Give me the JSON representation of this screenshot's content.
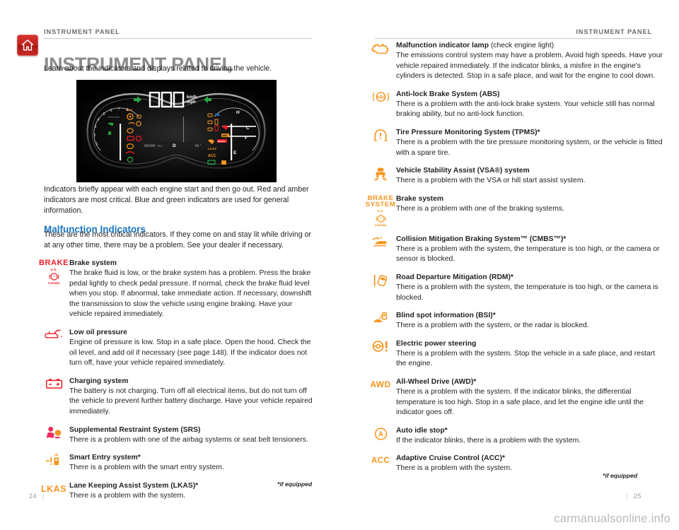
{
  "header": {
    "breadcrumb_left": "INSTRUMENT PANEL",
    "breadcrumb_right": "INSTRUMENT PANEL",
    "title": "INSTRUMENT PANEL",
    "intro": "Learn about the indicators and displays related to driving the vehicle.",
    "home_icon": "home-icon"
  },
  "colors": {
    "title_gray": "#8b8b8b",
    "section_blue": "#1b75bb",
    "red": "#ed1c24",
    "amber": "#f7941e",
    "home_red": "#c0241e",
    "rule_gray": "#c9c9c9"
  },
  "gauge": {
    "alt": "instrument-panel-cluster-illustration",
    "speed_digits": "000",
    "unit_top": "km/h",
    "unit_bottom": "mph",
    "odometer": "002345",
    "odometer_unit": "miles",
    "gear": "D",
    "temperature": "63",
    "temperature_unit": "F",
    "tach_labels": [
      "1",
      "2",
      "3",
      "4",
      "5",
      "6",
      "7",
      "8"
    ],
    "tach_unit": "x1000 r/min",
    "fuel_label_full": "F",
    "fuel_label_empty": "E",
    "temp_label_hot": "H",
    "temp_label_cold": "C",
    "cluster_badges": [
      "AWD",
      "LKAS",
      "ACC",
      "BRAKE"
    ]
  },
  "body": {
    "paragraph": "Indicators briefly appear with each engine start and then go out. Red and amber indicators are most critical. Blue and green indicators are used for general information.",
    "section_title": "Malfunction Indicators",
    "section_paragraph": "These are the most critical indicators. If they come on and stay lit while driving or at any other time, there may be a problem. See your dealer if necessary."
  },
  "footnotes": {
    "left": "*if equipped",
    "right": "*if equipped"
  },
  "folio": {
    "left_page": "24",
    "right_page": "25",
    "separator": "|"
  },
  "watermark": "carmanualsonline.info",
  "indicators_left": [
    {
      "icon": "brake-system-warning-icon",
      "icon_kind": "brake-text-red",
      "icon_text": "BRAKE",
      "icon_sub1": "U.S.",
      "icon_sub2": "Canada",
      "title": "Brake system",
      "desc": "The brake fluid is low, or the brake system has a problem. Press the brake pedal lightly to check pedal pressure. If normal, check the brake fluid level when you stop. If abnormal, take immediate action. If necessary, downshift the transmission to slow the vehicle using engine braking. Have your vehicle repaired immediately."
    },
    {
      "icon": "low-oil-pressure-icon",
      "icon_kind": "oil-can",
      "title": "Low oil pressure",
      "desc": "Engine oil pressure is low. Stop in a safe place. Open the hood. Check the oil level, and add oil if necessary (see page 148). If the indicator does not turn off, have your vehicle repaired immediately."
    },
    {
      "icon": "charging-system-icon",
      "icon_kind": "battery",
      "title": "Charging system",
      "desc": "The battery is not charging. Turn off all electrical items, but do not turn off the vehicle to prevent further battery discharge. Have your vehicle repaired immediately."
    },
    {
      "icon": "srs-airbag-icon",
      "icon_kind": "srs",
      "title": "Supplemental Restraint System (SRS)",
      "desc": "There is a problem with one of the airbag systems or seat belt tensioners."
    },
    {
      "icon": "smart-entry-icon",
      "icon_kind": "smart-entry",
      "title": "Smart Entry system*",
      "desc": "There is a problem with the smart entry system."
    },
    {
      "icon": "lkas-icon",
      "icon_kind": "lkas-text",
      "icon_text": "LKAS",
      "title": "Lane Keeping Assist System (LKAS)*",
      "desc": "There is a problem with the system."
    }
  ],
  "indicators_right": [
    {
      "icon": "check-engine-icon",
      "icon_kind": "engine",
      "title": "Malfunction indicator lamp",
      "title_regular": " (check engine light)",
      "desc": "The emissions control system may have a problem. Avoid high speeds. Have your vehicle repaired immediately. If the indicator blinks, a misfire in the engine's cylinders is detected. Stop in a safe place, and wait for the engine to cool down."
    },
    {
      "icon": "abs-icon",
      "icon_kind": "abs",
      "icon_text": "ABS",
      "title": "Anti-lock Brake System (ABS)",
      "desc": "There is a problem with the anti-lock brake system. Your vehicle still has normal braking ability, but no anti-lock function."
    },
    {
      "icon": "tpms-icon",
      "icon_kind": "tpms",
      "title": "Tire Pressure Monitoring System (TPMS)*",
      "desc": "There is a problem with the tire pressure monitoring system, or the vehicle is fitted with a spare tire."
    },
    {
      "icon": "vsa-icon",
      "icon_kind": "vsa",
      "title": "Vehicle Stability Assist (VSA®) system",
      "desc": "There is a problem with the VSA or hill start assist system."
    },
    {
      "icon": "brake-system-icon",
      "icon_kind": "brake-text-amber",
      "icon_text": "BRAKE",
      "icon_text2": "SYSTEM",
      "icon_sub1": "U.S.",
      "icon_sub2": "Canada",
      "title": "Brake system",
      "desc": "There is a problem with one of the braking systems."
    },
    {
      "icon": "cmbs-icon",
      "icon_kind": "cmbs",
      "title": "Collision Mitigation Braking System™ (CMBS™)*",
      "desc": "There is a problem with the system, the temperature is too high, or the camera or sensor is blocked."
    },
    {
      "icon": "rdm-icon",
      "icon_kind": "rdm",
      "title": "Road Departure Mitigation (RDM)*",
      "desc": "There is a problem with the system, the temperature is too high, or the camera is blocked."
    },
    {
      "icon": "blind-spot-icon",
      "icon_kind": "bsi",
      "title": "Blind spot information (BSI)*",
      "desc": "There is a problem with the system, or the radar is blocked."
    },
    {
      "icon": "electric-power-steering-icon",
      "icon_kind": "eps",
      "title": "Electric power steering",
      "desc": "There is a problem with the system. Stop the vehicle in a safe place, and restart the engine."
    },
    {
      "icon": "awd-icon",
      "icon_kind": "awd-text",
      "icon_text": "AWD",
      "title": "All-Wheel Drive (AWD)*",
      "desc": "There is a problem with the system. If the indicator blinks, the differential temperature is too high. Stop in a safe place, and let the engine idle until the indicator goes off."
    },
    {
      "icon": "auto-idle-stop-icon",
      "icon_kind": "auto-idle",
      "icon_text": "A",
      "title": "Auto idle stop*",
      "desc": "If the indicator blinks, there is a problem with the system."
    },
    {
      "icon": "acc-icon",
      "icon_kind": "acc-text",
      "icon_text": "ACC",
      "title": "Adaptive Cruise Control (ACC)*",
      "desc": "There is a problem with the system."
    }
  ]
}
